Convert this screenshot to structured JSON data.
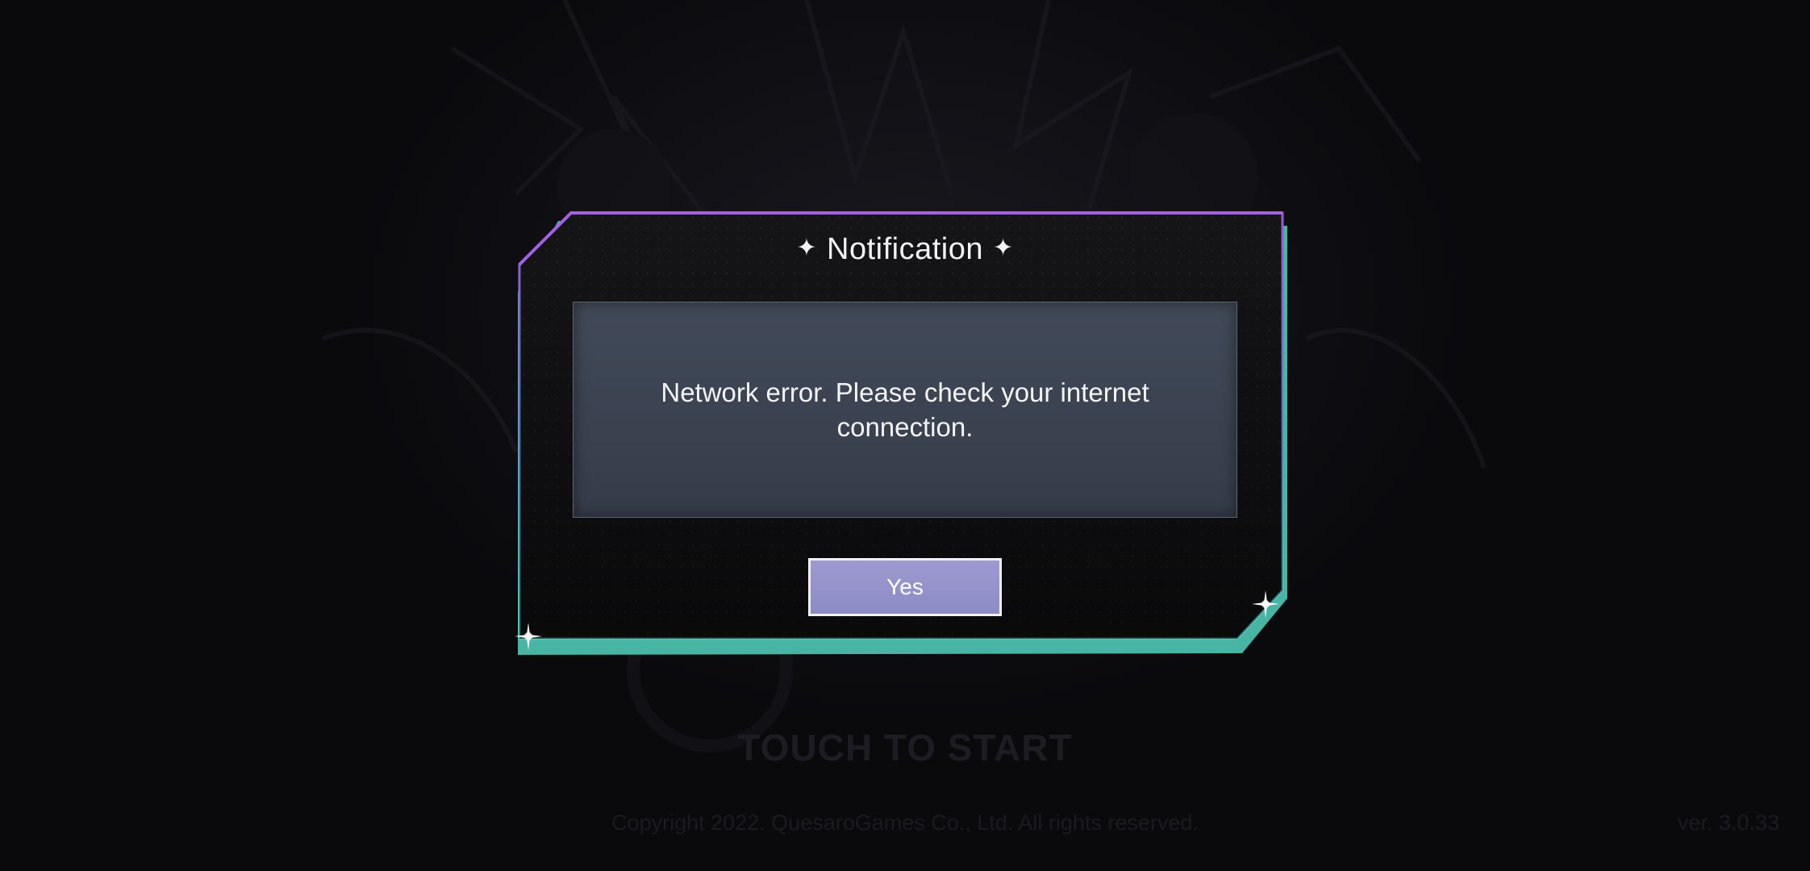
{
  "background": {
    "touch_to_start": "TOUCH TO START",
    "copyright": "Copyright 2022. QuesaroGames Co., Ltd. All rights reserved.",
    "version": "ver. 3.0.33"
  },
  "dialog": {
    "title": "Notification",
    "sparkle_icon": "sparkle-icon",
    "message": "Network error. Please check your internet connection.",
    "yes_label": "Yes"
  },
  "colors": {
    "frame_top": "#9b59d9",
    "frame_bottom": "#4fc6b5",
    "button_fill": "#9c9ad0",
    "message_bg": "#3d4654"
  }
}
